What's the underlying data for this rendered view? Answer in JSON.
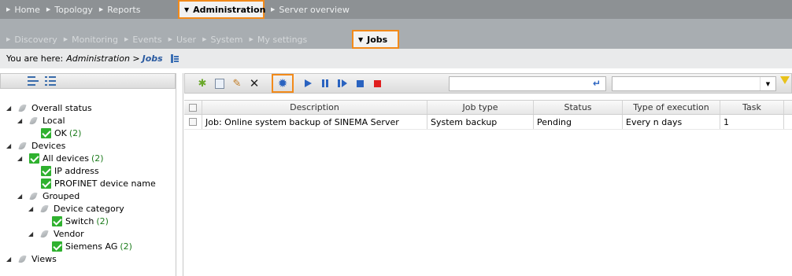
{
  "nav_primary": {
    "items": [
      {
        "label": "Home"
      },
      {
        "label": "Topology"
      },
      {
        "label": "Reports"
      },
      {
        "label": "Administration",
        "active": true
      },
      {
        "label": "Server overview"
      }
    ]
  },
  "nav_secondary": {
    "items": [
      {
        "label": "Discovery"
      },
      {
        "label": "Monitoring"
      },
      {
        "label": "Events"
      },
      {
        "label": "User"
      },
      {
        "label": "System"
      },
      {
        "label": "My settings"
      },
      {
        "label": "Jobs",
        "active": true
      }
    ]
  },
  "breadcrumb": {
    "prefix": "You are here:",
    "path": "Administration >",
    "current": "Jobs"
  },
  "tree": {
    "nodes": [
      {
        "label": "Overall status",
        "icon": "status-leaf-icon",
        "count": ""
      },
      {
        "label": "Local",
        "icon": "status-leaf-icon",
        "count": ""
      },
      {
        "label": "OK",
        "icon": "check-icon",
        "count": "(2)"
      },
      {
        "label": "Devices",
        "icon": "status-leaf-icon",
        "count": ""
      },
      {
        "label": "All devices",
        "icon": "check-icon",
        "count": "(2)"
      },
      {
        "label": "IP address",
        "icon": "check-icon",
        "count": ""
      },
      {
        "label": "PROFINET device name",
        "icon": "check-icon",
        "count": ""
      },
      {
        "label": "Grouped",
        "icon": "status-leaf-icon",
        "count": ""
      },
      {
        "label": "Device category",
        "icon": "status-leaf-icon",
        "count": ""
      },
      {
        "label": "Switch",
        "icon": "check-icon",
        "count": "(2)"
      },
      {
        "label": "Vendor",
        "icon": "status-leaf-icon",
        "count": ""
      },
      {
        "label": "Siemens AG",
        "icon": "check-icon",
        "count": "(2)"
      },
      {
        "label": "Views",
        "icon": "status-leaf-icon",
        "count": ""
      }
    ]
  },
  "toolbar": {
    "icons": [
      "new-job-icon",
      "copy-icon",
      "edit-icon",
      "delete-icon",
      "settings-gear-icon",
      "play-icon",
      "pause-icon",
      "step-icon",
      "stop-icon",
      "stop-red-icon",
      "refresh-icon",
      "filter-icon"
    ],
    "search_value": "",
    "filter_value": ""
  },
  "table": {
    "columns": [
      "Description",
      "Job type",
      "Status",
      "Type of execution",
      "Task"
    ],
    "rows": [
      [
        "Job: Online system backup of SINEMA Server",
        "System backup",
        "Pending",
        "Every n days",
        "1"
      ]
    ]
  },
  "colors": {
    "highlight": "#f28a1a",
    "nav_primary_bg": "#8d9194",
    "nav_secondary_bg": "#a8adb1",
    "accent_blue": "#2a63c0",
    "check_green": "#2fb12f"
  }
}
